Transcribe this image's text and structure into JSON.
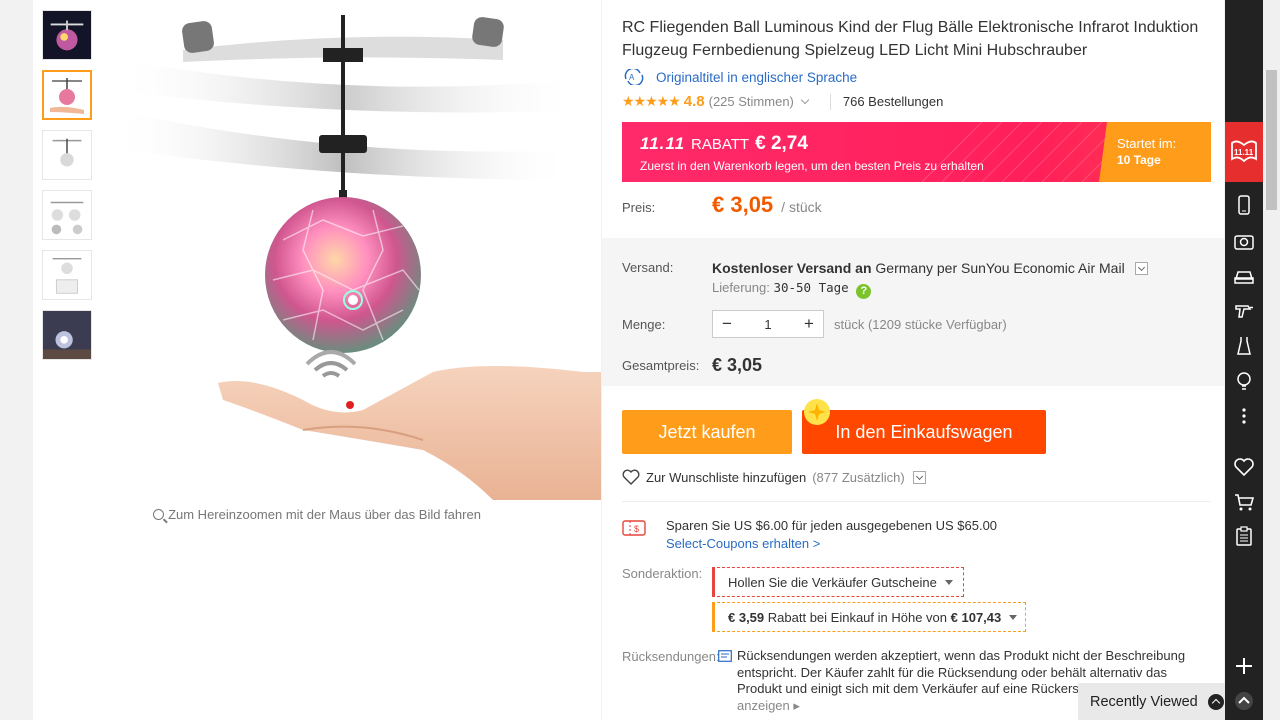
{
  "product": {
    "title": "RC Fliegenden Ball Luminous Kind der Flug Bälle Elektronische Infrarot Induktion Flugzeug Fernbedienung Spielzeug LED Licht Mini Hubschrauber",
    "original_title_link": "Originaltitel in englischer Sprache",
    "rating_score": "4.8",
    "rating_votes": "(225 Stimmen)",
    "orders": "766 Bestellungen",
    "stars": "★★★★★"
  },
  "gallery": {
    "zoom_hint": "Zum Hereinzoomen mit der Maus über das Bild fahren",
    "thumbnails": [
      "thumb-1",
      "thumb-2",
      "thumb-3",
      "thumb-4",
      "thumb-5",
      "thumb-6"
    ],
    "active_thumbnail": 2
  },
  "promo": {
    "badge": "11.11",
    "discount_label": "RABATT",
    "discount_amount": "€ 2,74",
    "subline": "Zuerst in den Warenkorb legen, um den besten Preis zu erhalten",
    "start_label": "Startet im:",
    "start_days": "10 Tage"
  },
  "price": {
    "label": "Preis:",
    "value": "€ 3,05",
    "unit": "/ stück"
  },
  "shipping": {
    "label": "Versand:",
    "prefix": "Kostenloser Versand an",
    "country": "Germany",
    "via": "per SunYou Economic Air Mail",
    "delivery_label": "Lieferung:",
    "delivery_days": "30-50 Tage"
  },
  "quantity": {
    "label": "Menge:",
    "value": "1",
    "minus": "−",
    "plus": "+",
    "stock": "stück (1209 stücke Verfügbar)"
  },
  "total": {
    "label": "Gesamtpreis:",
    "value": "€ 3,05"
  },
  "actions": {
    "buy_now": "Jetzt kaufen",
    "add_to_cart": "In den Einkaufswagen",
    "wishlist": "Zur Wunschliste hinzufügen",
    "wishlist_count": "(877 Zusätzlich)"
  },
  "coupon": {
    "text": "Sparen Sie US $6.00 für jeden ausgegebenen US $65.00",
    "link": "Select-Coupons erhalten >"
  },
  "special": {
    "label": "Sonderaktion:",
    "seller_coupons": "Hollen Sie die Verkäufer Gutscheine",
    "discount_amount": "€ 3,59",
    "discount_mid": "Rabatt bei Einkauf in Höhe von",
    "discount_threshold": "€ 107,43"
  },
  "returns": {
    "label": "Rücksendungen:",
    "text": "Rücksendungen werden akzeptiert, wenn das Produkt nicht der Beschreibung entspricht. Der Käufer zahlt für die Rücksendung oder behält alternativ das Produkt und einigt sich mit dem Verkäufer auf eine Rückerstattung.",
    "more": "Details anzeigen"
  },
  "sidebar": {
    "badge": "11.11",
    "icons": [
      "phone-icon",
      "camera-icon",
      "car-icon",
      "drill-icon",
      "dress-icon",
      "lightbulb-icon",
      "more-icon",
      "heart-icon",
      "cart-icon",
      "clipboard-icon",
      "plus-icon",
      "scroll-top-icon"
    ]
  },
  "recently_viewed": "Recently Viewed",
  "colors": {
    "accent_orange": "#ff9c1a",
    "cart_red": "#ff4700",
    "price_orange": "#f05b00",
    "promo_pink": "#ff1f5a",
    "link_blue": "#2a6bc6"
  }
}
